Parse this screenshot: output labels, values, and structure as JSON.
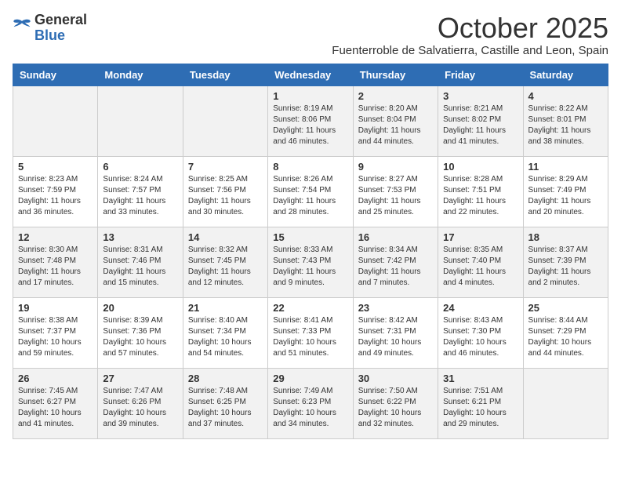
{
  "logo": {
    "general": "General",
    "blue": "Blue"
  },
  "title": "October 2025",
  "subtitle": "Fuenterroble de Salvatierra, Castille and Leon, Spain",
  "days_of_week": [
    "Sunday",
    "Monday",
    "Tuesday",
    "Wednesday",
    "Thursday",
    "Friday",
    "Saturday"
  ],
  "weeks": [
    [
      {
        "day": "",
        "info": ""
      },
      {
        "day": "",
        "info": ""
      },
      {
        "day": "",
        "info": ""
      },
      {
        "day": "1",
        "info": "Sunrise: 8:19 AM\nSunset: 8:06 PM\nDaylight: 11 hours and 46 minutes."
      },
      {
        "day": "2",
        "info": "Sunrise: 8:20 AM\nSunset: 8:04 PM\nDaylight: 11 hours and 44 minutes."
      },
      {
        "day": "3",
        "info": "Sunrise: 8:21 AM\nSunset: 8:02 PM\nDaylight: 11 hours and 41 minutes."
      },
      {
        "day": "4",
        "info": "Sunrise: 8:22 AM\nSunset: 8:01 PM\nDaylight: 11 hours and 38 minutes."
      }
    ],
    [
      {
        "day": "5",
        "info": "Sunrise: 8:23 AM\nSunset: 7:59 PM\nDaylight: 11 hours and 36 minutes."
      },
      {
        "day": "6",
        "info": "Sunrise: 8:24 AM\nSunset: 7:57 PM\nDaylight: 11 hours and 33 minutes."
      },
      {
        "day": "7",
        "info": "Sunrise: 8:25 AM\nSunset: 7:56 PM\nDaylight: 11 hours and 30 minutes."
      },
      {
        "day": "8",
        "info": "Sunrise: 8:26 AM\nSunset: 7:54 PM\nDaylight: 11 hours and 28 minutes."
      },
      {
        "day": "9",
        "info": "Sunrise: 8:27 AM\nSunset: 7:53 PM\nDaylight: 11 hours and 25 minutes."
      },
      {
        "day": "10",
        "info": "Sunrise: 8:28 AM\nSunset: 7:51 PM\nDaylight: 11 hours and 22 minutes."
      },
      {
        "day": "11",
        "info": "Sunrise: 8:29 AM\nSunset: 7:49 PM\nDaylight: 11 hours and 20 minutes."
      }
    ],
    [
      {
        "day": "12",
        "info": "Sunrise: 8:30 AM\nSunset: 7:48 PM\nDaylight: 11 hours and 17 minutes."
      },
      {
        "day": "13",
        "info": "Sunrise: 8:31 AM\nSunset: 7:46 PM\nDaylight: 11 hours and 15 minutes."
      },
      {
        "day": "14",
        "info": "Sunrise: 8:32 AM\nSunset: 7:45 PM\nDaylight: 11 hours and 12 minutes."
      },
      {
        "day": "15",
        "info": "Sunrise: 8:33 AM\nSunset: 7:43 PM\nDaylight: 11 hours and 9 minutes."
      },
      {
        "day": "16",
        "info": "Sunrise: 8:34 AM\nSunset: 7:42 PM\nDaylight: 11 hours and 7 minutes."
      },
      {
        "day": "17",
        "info": "Sunrise: 8:35 AM\nSunset: 7:40 PM\nDaylight: 11 hours and 4 minutes."
      },
      {
        "day": "18",
        "info": "Sunrise: 8:37 AM\nSunset: 7:39 PM\nDaylight: 11 hours and 2 minutes."
      }
    ],
    [
      {
        "day": "19",
        "info": "Sunrise: 8:38 AM\nSunset: 7:37 PM\nDaylight: 10 hours and 59 minutes."
      },
      {
        "day": "20",
        "info": "Sunrise: 8:39 AM\nSunset: 7:36 PM\nDaylight: 10 hours and 57 minutes."
      },
      {
        "day": "21",
        "info": "Sunrise: 8:40 AM\nSunset: 7:34 PM\nDaylight: 10 hours and 54 minutes."
      },
      {
        "day": "22",
        "info": "Sunrise: 8:41 AM\nSunset: 7:33 PM\nDaylight: 10 hours and 51 minutes."
      },
      {
        "day": "23",
        "info": "Sunrise: 8:42 AM\nSunset: 7:31 PM\nDaylight: 10 hours and 49 minutes."
      },
      {
        "day": "24",
        "info": "Sunrise: 8:43 AM\nSunset: 7:30 PM\nDaylight: 10 hours and 46 minutes."
      },
      {
        "day": "25",
        "info": "Sunrise: 8:44 AM\nSunset: 7:29 PM\nDaylight: 10 hours and 44 minutes."
      }
    ],
    [
      {
        "day": "26",
        "info": "Sunrise: 7:45 AM\nSunset: 6:27 PM\nDaylight: 10 hours and 41 minutes."
      },
      {
        "day": "27",
        "info": "Sunrise: 7:47 AM\nSunset: 6:26 PM\nDaylight: 10 hours and 39 minutes."
      },
      {
        "day": "28",
        "info": "Sunrise: 7:48 AM\nSunset: 6:25 PM\nDaylight: 10 hours and 37 minutes."
      },
      {
        "day": "29",
        "info": "Sunrise: 7:49 AM\nSunset: 6:23 PM\nDaylight: 10 hours and 34 minutes."
      },
      {
        "day": "30",
        "info": "Sunrise: 7:50 AM\nSunset: 6:22 PM\nDaylight: 10 hours and 32 minutes."
      },
      {
        "day": "31",
        "info": "Sunrise: 7:51 AM\nSunset: 6:21 PM\nDaylight: 10 hours and 29 minutes."
      },
      {
        "day": "",
        "info": ""
      }
    ]
  ]
}
